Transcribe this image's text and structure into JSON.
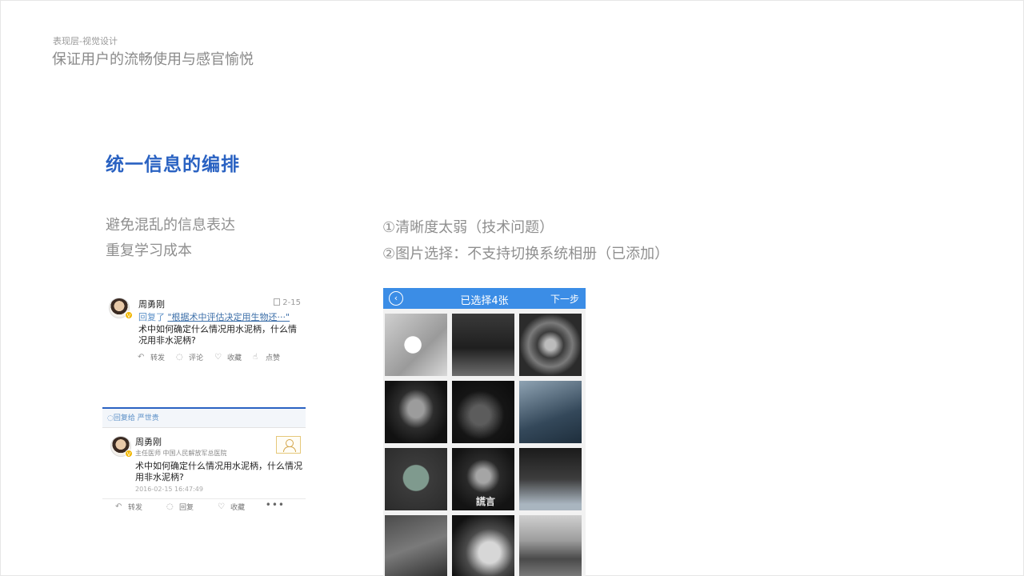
{
  "header": {
    "subtitle": "表现层-视觉设计",
    "title": "保证用户的流畅使用与感官愉悦"
  },
  "section_title": "统一信息的编排",
  "left_points": [
    "避免混乱的信息表达",
    "重复学习成本"
  ],
  "right_points": [
    "①清晰度太弱（技术问题）",
    "②图片选择：不支持切换系统相册（已添加）"
  ],
  "card1": {
    "name": "周勇刚",
    "badge": "V",
    "date": "2-15",
    "reply_prefix": "回复了",
    "reply_quote": "\"根据术中评估决定用生物还···\"",
    "content": "术中如何确定什么情况用水泥柄，什么情况用非水泥柄?",
    "actions": [
      {
        "icon": "forward-icon",
        "label": "转发"
      },
      {
        "icon": "comment-icon",
        "label": "评论"
      },
      {
        "icon": "heart-icon",
        "label": "收藏"
      },
      {
        "icon": "like-icon",
        "label": "点赞"
      }
    ]
  },
  "card2": {
    "reply_to": "回复给 严世贵",
    "name": "周勇刚",
    "badge": "V",
    "doctor_title": "主任医师 中国人民解放军总医院",
    "content": "术中如何确定什么情况用水泥柄，什么情况用非水泥柄?",
    "timestamp": "2016-02-15 16:47:49",
    "actions": [
      {
        "icon": "forward-icon",
        "label": "转发"
      },
      {
        "icon": "comment-icon",
        "label": "回复"
      },
      {
        "icon": "heart-icon",
        "label": "收藏"
      }
    ],
    "more": "•••"
  },
  "picker": {
    "back_icon": "‹",
    "title": "已选择4张",
    "next": "下一步",
    "tile_text": "謊言"
  },
  "colors": {
    "accent_blue": "#2a62c2",
    "picker_bar": "#3b8de6",
    "verified_badge": "#f1b600"
  }
}
